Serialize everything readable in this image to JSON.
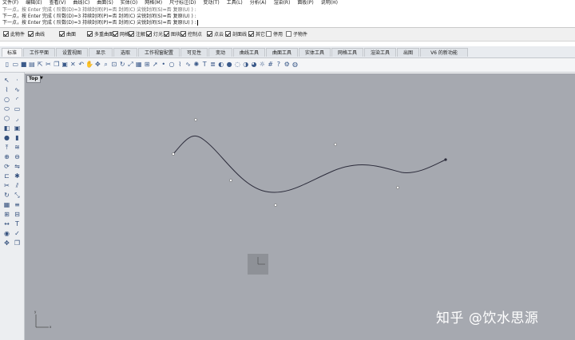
{
  "menu": [
    "文件(F)",
    "编辑(E)",
    "查看(V)",
    "曲线(C)",
    "曲面(S)",
    "实体(O)",
    "网格(M)",
    "尺寸标注(D)",
    "变动(T)",
    "工具(L)",
    "分析(A)",
    "渲染(R)",
    "面板(P)",
    "说明(H)"
  ],
  "command_history": {
    "line1": "下一点，按 Enter 完成 ( 阶数(D)=3  持续封闭(P)=否  封闭(C)  尖锐封闭(S)=否  复原(U) ) :",
    "line2": "下一点，按 Enter 完成 ( 阶数(D)=3  持续封闭(P)=否  封闭(C)  尖锐封闭(S)=否  复原(U) ) :",
    "line3": "下一点，按 Enter 完成 ( 阶数(D)=3  持续封闭(P)=否  封闭(C)  尖锐封闭(S)=否  复原(U) ) :"
  },
  "osnap": [
    {
      "label": "此物件",
      "on": true
    },
    {
      "label": "曲线",
      "on": true
    },
    {
      "label": "曲面",
      "on": true
    },
    {
      "label": "多重曲面",
      "on": true
    },
    {
      "label": "网格",
      "on": true
    },
    {
      "label": "注解",
      "on": true
    },
    {
      "label": "灯光",
      "on": true
    },
    {
      "label": "图块",
      "on": true
    },
    {
      "label": "控制点",
      "on": true
    },
    {
      "label": "点云",
      "on": true
    },
    {
      "label": "剖面线",
      "on": true
    },
    {
      "label": "其它",
      "on": true
    },
    {
      "label": "停用",
      "on": false
    },
    {
      "label": "子物件",
      "on": false
    }
  ],
  "tabs": [
    "标准",
    "工作平面",
    "设置视图",
    "显示",
    "选取",
    "工作视窗配置",
    "可见性",
    "变动",
    "曲线工具",
    "曲面工具",
    "实体工具",
    "网格工具",
    "渲染工具",
    "出图",
    "V6 的新功能"
  ],
  "active_tab": "标准",
  "toolbar_icons": [
    "new-file-icon",
    "open-icon",
    "save-icon",
    "print-icon",
    "import-icon",
    "cut-icon",
    "copy-icon",
    "paste-icon",
    "delete-icon",
    "undo-icon",
    "pan-icon",
    "move-view-icon",
    "zoom-icon",
    "zoom-window-icon",
    "rotate-view-icon",
    "zoom-extents-icon",
    "four-view-icon",
    "layout-icon",
    "select-icon",
    "point-icon",
    "circle-icon",
    "polyline-icon",
    "curve-icon",
    "light-icon",
    "text-icon",
    "layer-icon",
    "material-icon",
    "render-icon",
    "ghost-icon",
    "shaded-icon",
    "rendered-icon",
    "sun-icon",
    "grid-icon",
    "help-icon",
    "settings-icon",
    "globe-icon"
  ],
  "viewport": {
    "name": "Top",
    "menu_arrow": "▼",
    "colors": {
      "background": "#a6a9b0",
      "curve": "#2b2b3a",
      "control_point": "#ffffff"
    }
  },
  "watermark": "知乎 @饮水思源"
}
